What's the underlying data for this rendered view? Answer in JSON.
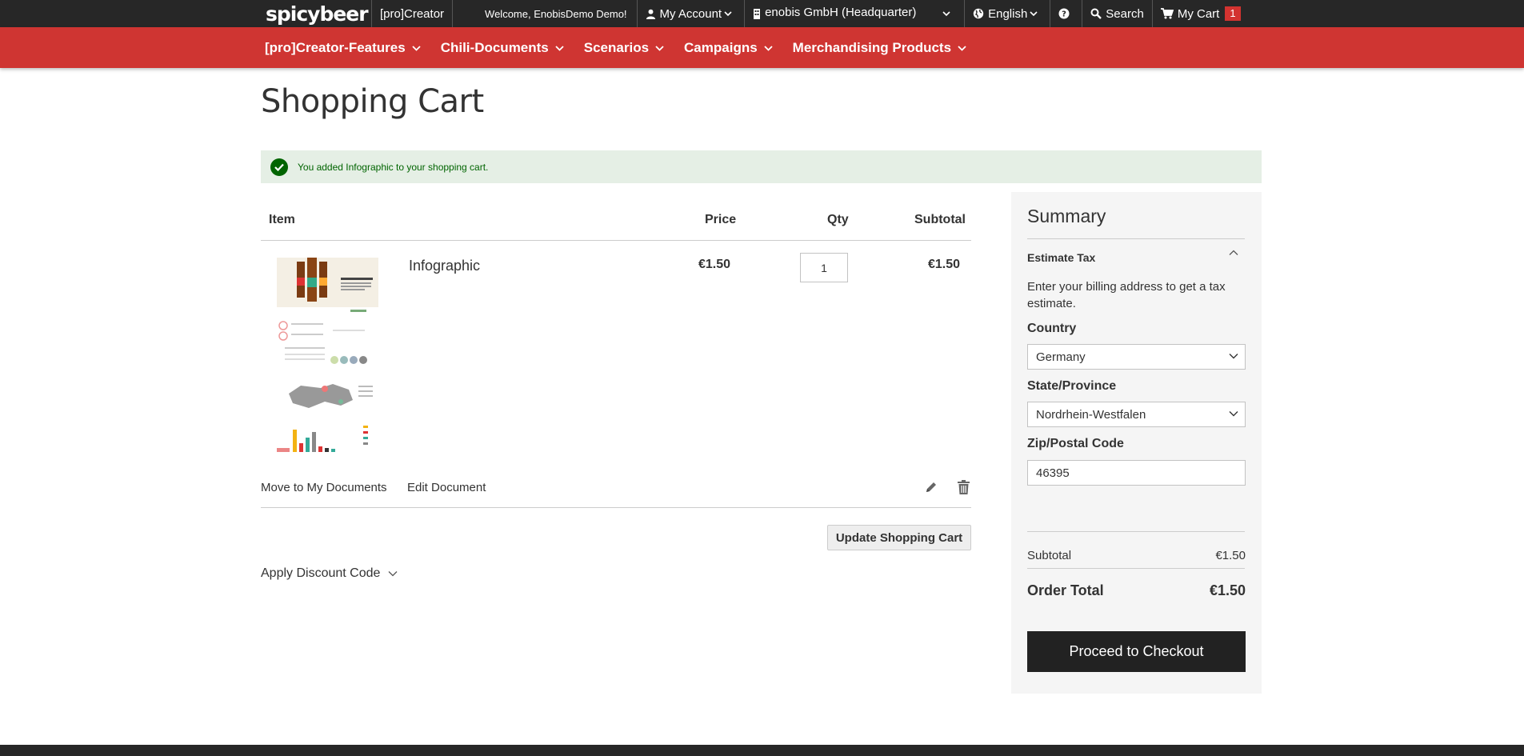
{
  "topbar": {
    "logo": "spicybeer",
    "creator": "[pro]Creator",
    "welcome": "Welcome, EnobisDemo Demo!",
    "my_account": "My Account",
    "company": "enobis GmbH (Headquarter)",
    "language": "English",
    "search": "Search",
    "my_cart": "My Cart",
    "cart_count": "1"
  },
  "nav": {
    "items": [
      {
        "label": "[pro]Creator-Features"
      },
      {
        "label": "Chili-Documents"
      },
      {
        "label": "Scenarios"
      },
      {
        "label": "Campaigns"
      },
      {
        "label": "Merchandising Products"
      }
    ]
  },
  "page": {
    "title": "Shopping Cart",
    "message": "You added Infographic to your shopping cart."
  },
  "cart": {
    "headers": {
      "item": "Item",
      "price": "Price",
      "qty": "Qty",
      "subtotal": "Subtotal"
    },
    "items": [
      {
        "name": "Infographic",
        "price": "€1.50",
        "qty": "1",
        "subtotal": "€1.50"
      }
    ],
    "move_to_docs": "Move to My Documents",
    "edit_doc": "Edit Document",
    "update_btn": "Update Shopping Cart",
    "discount": "Apply Discount Code"
  },
  "summary": {
    "title": "Summary",
    "estimate_tax": "Estimate Tax",
    "tax_desc": "Enter your billing address to get a tax estimate.",
    "country_label": "Country",
    "country_value": "Germany",
    "state_label": "State/Province",
    "state_value": "Nordrhein-Westfalen",
    "zip_label": "Zip/Postal Code",
    "zip_value": "46395",
    "subtotal_label": "Subtotal",
    "subtotal_value": "€1.50",
    "order_total_label": "Order Total",
    "order_total_value": "€1.50",
    "checkout": "Proceed to Checkout"
  },
  "colors": {
    "topbar": "#272727",
    "nav": "#cf3532",
    "success_bg": "#e5efe5",
    "success_fg": "#006400",
    "checkout": "#222222"
  }
}
